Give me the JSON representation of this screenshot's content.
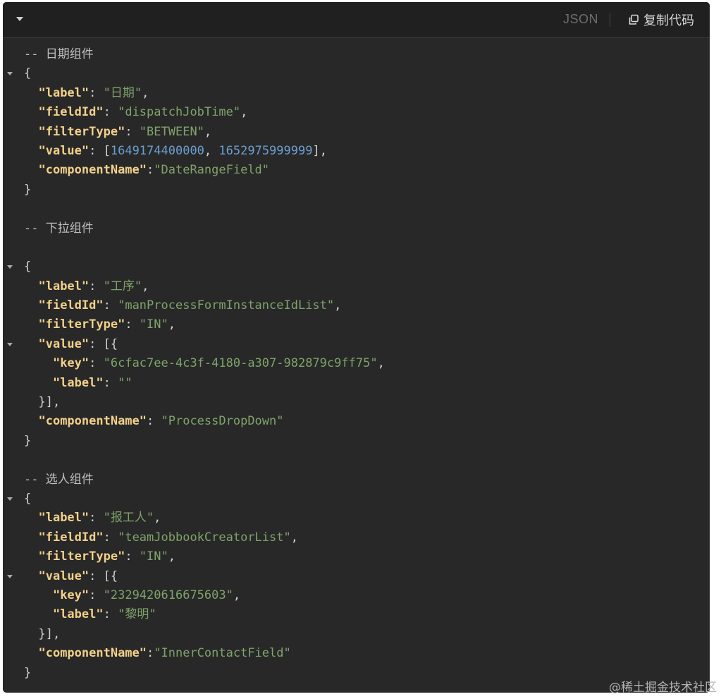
{
  "header": {
    "language": "JSON",
    "copy_label": "复制代码"
  },
  "code_lines": [
    [
      {
        "t": "-- 日期组件",
        "c": "c"
      }
    ],
    [
      {
        "t": "{",
        "c": "p"
      }
    ],
    [
      {
        "t": "  ",
        "c": "p"
      },
      {
        "t": "\"label\"",
        "c": "k"
      },
      {
        "t": ": ",
        "c": "p"
      },
      {
        "t": "\"日期\"",
        "c": "s"
      },
      {
        "t": ",",
        "c": "p"
      }
    ],
    [
      {
        "t": "  ",
        "c": "p"
      },
      {
        "t": "\"fieldId\"",
        "c": "k"
      },
      {
        "t": ": ",
        "c": "p"
      },
      {
        "t": "\"dispatchJobTime\"",
        "c": "s"
      },
      {
        "t": ",",
        "c": "p"
      }
    ],
    [
      {
        "t": "  ",
        "c": "p"
      },
      {
        "t": "\"filterType\"",
        "c": "k"
      },
      {
        "t": ": ",
        "c": "p"
      },
      {
        "t": "\"BETWEEN\"",
        "c": "s"
      },
      {
        "t": ",",
        "c": "p"
      }
    ],
    [
      {
        "t": "  ",
        "c": "p"
      },
      {
        "t": "\"value\"",
        "c": "k"
      },
      {
        "t": ": [",
        "c": "p"
      },
      {
        "t": "1649174400000",
        "c": "n"
      },
      {
        "t": ", ",
        "c": "p"
      },
      {
        "t": "1652975999999",
        "c": "n"
      },
      {
        "t": "],",
        "c": "p"
      }
    ],
    [
      {
        "t": "  ",
        "c": "p"
      },
      {
        "t": "\"componentName\"",
        "c": "k"
      },
      {
        "t": ":",
        "c": "p"
      },
      {
        "t": "\"DateRangeField\"",
        "c": "s"
      }
    ],
    [
      {
        "t": "}",
        "c": "p"
      }
    ],
    [],
    [
      {
        "t": "-- 下拉组件",
        "c": "c"
      }
    ],
    [],
    [
      {
        "t": "{",
        "c": "p"
      }
    ],
    [
      {
        "t": "  ",
        "c": "p"
      },
      {
        "t": "\"label\"",
        "c": "k"
      },
      {
        "t": ": ",
        "c": "p"
      },
      {
        "t": "\"工序\"",
        "c": "s"
      },
      {
        "t": ",",
        "c": "p"
      }
    ],
    [
      {
        "t": "  ",
        "c": "p"
      },
      {
        "t": "\"fieldId\"",
        "c": "k"
      },
      {
        "t": ": ",
        "c": "p"
      },
      {
        "t": "\"manProcessFormInstanceIdList\"",
        "c": "s"
      },
      {
        "t": ",",
        "c": "p"
      }
    ],
    [
      {
        "t": "  ",
        "c": "p"
      },
      {
        "t": "\"filterType\"",
        "c": "k"
      },
      {
        "t": ": ",
        "c": "p"
      },
      {
        "t": "\"IN\"",
        "c": "s"
      },
      {
        "t": ",",
        "c": "p"
      }
    ],
    [
      {
        "t": "  ",
        "c": "p"
      },
      {
        "t": "\"value\"",
        "c": "k"
      },
      {
        "t": ": [{",
        "c": "p"
      }
    ],
    [
      {
        "t": "    ",
        "c": "p"
      },
      {
        "t": "\"key\"",
        "c": "k"
      },
      {
        "t": ": ",
        "c": "p"
      },
      {
        "t": "\"6cfac7ee-4c3f-4180-a307-982879c9ff75\"",
        "c": "s"
      },
      {
        "t": ",",
        "c": "p"
      }
    ],
    [
      {
        "t": "    ",
        "c": "p"
      },
      {
        "t": "\"label\"",
        "c": "k"
      },
      {
        "t": ": ",
        "c": "p"
      },
      {
        "t": "\"\"",
        "c": "s"
      }
    ],
    [
      {
        "t": "  }],",
        "c": "p"
      }
    ],
    [
      {
        "t": "  ",
        "c": "p"
      },
      {
        "t": "\"componentName\"",
        "c": "k"
      },
      {
        "t": ": ",
        "c": "p"
      },
      {
        "t": "\"ProcessDropDown\"",
        "c": "s"
      }
    ],
    [
      {
        "t": "}",
        "c": "p"
      }
    ],
    [],
    [
      {
        "t": "-- 选人组件",
        "c": "c"
      }
    ],
    [
      {
        "t": "{",
        "c": "p"
      }
    ],
    [
      {
        "t": "  ",
        "c": "p"
      },
      {
        "t": "\"label\"",
        "c": "k"
      },
      {
        "t": ": ",
        "c": "p"
      },
      {
        "t": "\"报工人\"",
        "c": "s"
      },
      {
        "t": ",",
        "c": "p"
      }
    ],
    [
      {
        "t": "  ",
        "c": "p"
      },
      {
        "t": "\"fieldId\"",
        "c": "k"
      },
      {
        "t": ": ",
        "c": "p"
      },
      {
        "t": "\"teamJobbookCreatorList\"",
        "c": "s"
      },
      {
        "t": ",",
        "c": "p"
      }
    ],
    [
      {
        "t": "  ",
        "c": "p"
      },
      {
        "t": "\"filterType\"",
        "c": "k"
      },
      {
        "t": ": ",
        "c": "p"
      },
      {
        "t": "\"IN\"",
        "c": "s"
      },
      {
        "t": ",",
        "c": "p"
      }
    ],
    [
      {
        "t": "  ",
        "c": "p"
      },
      {
        "t": "\"value\"",
        "c": "k"
      },
      {
        "t": ": [{",
        "c": "p"
      }
    ],
    [
      {
        "t": "    ",
        "c": "p"
      },
      {
        "t": "\"key\"",
        "c": "k"
      },
      {
        "t": ": ",
        "c": "p"
      },
      {
        "t": "\"2329420616675603\"",
        "c": "s"
      },
      {
        "t": ",",
        "c": "p"
      }
    ],
    [
      {
        "t": "    ",
        "c": "p"
      },
      {
        "t": "\"label\"",
        "c": "k"
      },
      {
        "t": ": ",
        "c": "p"
      },
      {
        "t": "\"黎明\"",
        "c": "s"
      }
    ],
    [
      {
        "t": "  }],",
        "c": "p"
      }
    ],
    [
      {
        "t": "  ",
        "c": "p"
      },
      {
        "t": "\"componentName\"",
        "c": "k"
      },
      {
        "t": ":",
        "c": "p"
      },
      {
        "t": "\"InnerContactField\"",
        "c": "s"
      }
    ],
    [
      {
        "t": "}",
        "c": "p"
      }
    ]
  ],
  "fold_markers": [
    1,
    11,
    15,
    23,
    27
  ],
  "watermark": "@稀土掘金技术社区"
}
